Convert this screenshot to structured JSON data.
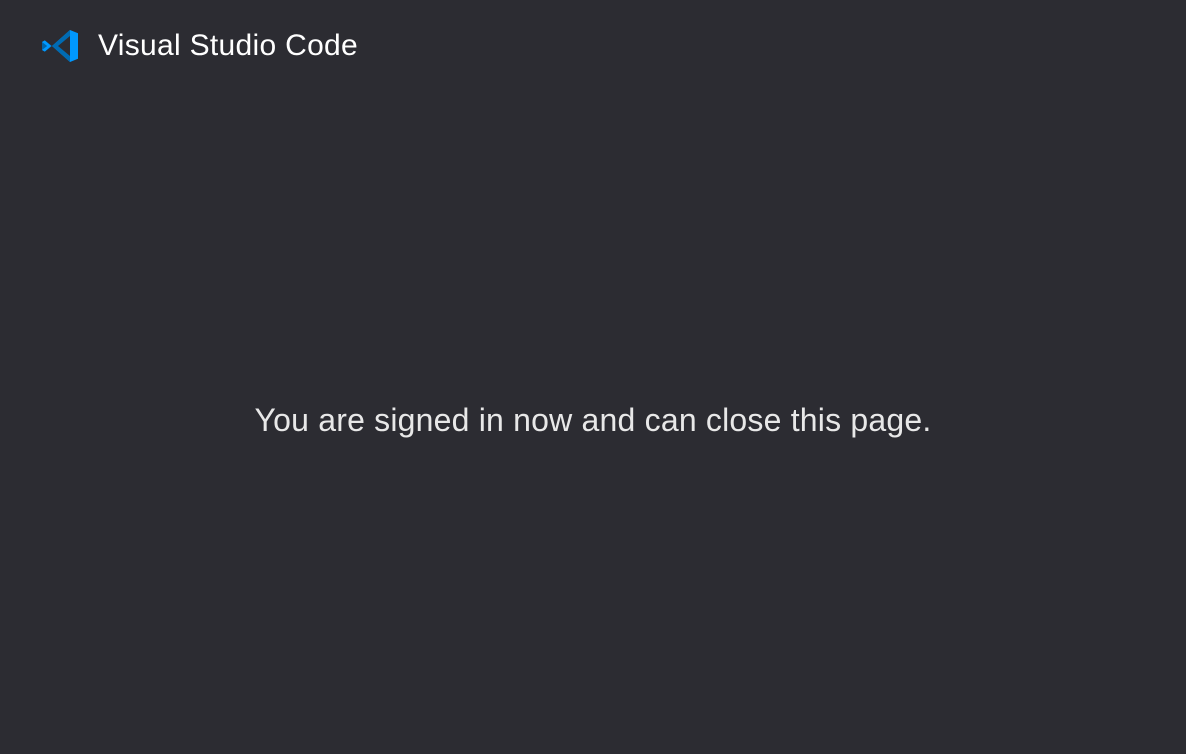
{
  "header": {
    "app_name": "Visual Studio Code"
  },
  "main": {
    "message": "You are signed in now and can close this page."
  }
}
